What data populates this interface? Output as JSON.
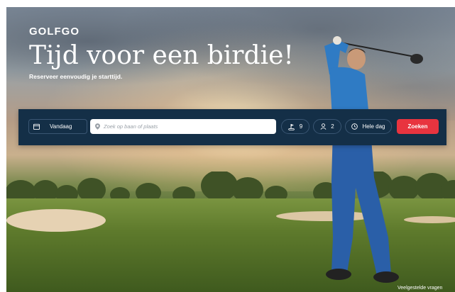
{
  "brand": {
    "logo_text": "GOLFGO"
  },
  "hero": {
    "headline": "Tijd voor een birdie!",
    "subline": "Reserveer eenvoudig je starttijd."
  },
  "search": {
    "date_label": "Vandaag",
    "location_placeholder": "Zoek op baan of plaats",
    "holes_value": "9",
    "players_value": "2",
    "time_label": "Hele dag",
    "submit_label": "Zoeken"
  },
  "footer": {
    "faq_link": "Veelgestelde vragen"
  },
  "icons": {
    "date": "calendar-icon",
    "location": "map-pin-icon",
    "holes": "golf-flag-icon",
    "players": "user-icon",
    "time": "clock-icon"
  },
  "colors": {
    "search_bar": "#142f47",
    "submit_button": "#e8343f",
    "text_light": "#ffffff"
  }
}
